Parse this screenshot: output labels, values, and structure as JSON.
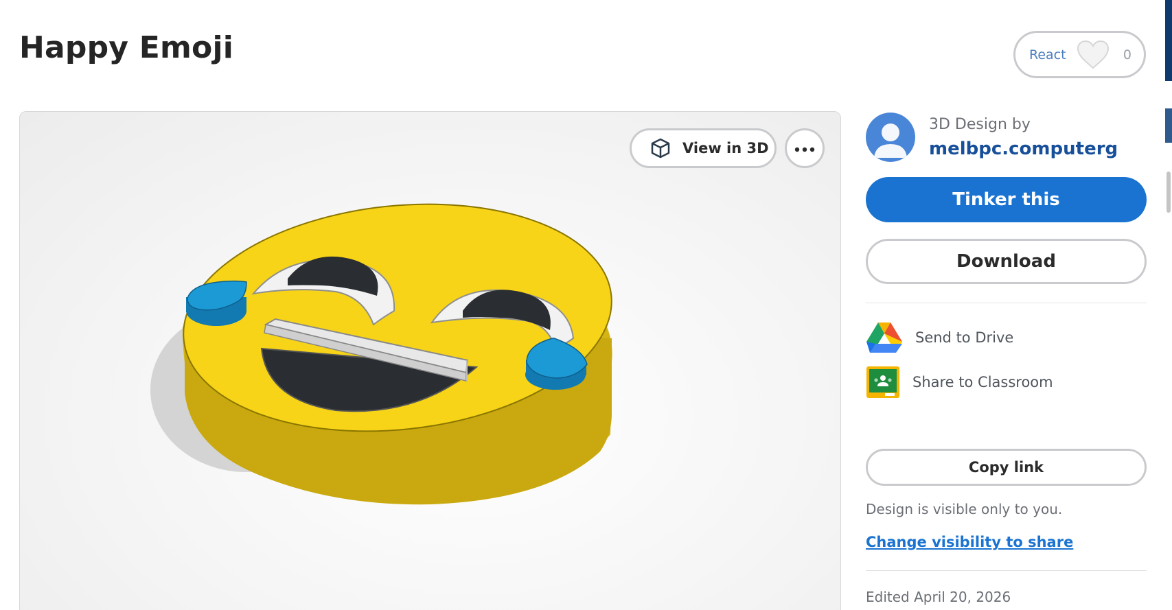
{
  "page": {
    "title": "Happy Emoji"
  },
  "react": {
    "label": "React",
    "count": "0",
    "icon": "heart-icon"
  },
  "viewer": {
    "view3d_label": "View in 3D",
    "view3d_icon": "cube-icon",
    "more_icon": "more-options-icon"
  },
  "designer": {
    "caption": "3D Design by",
    "name": "melbpc.computerg"
  },
  "actions": {
    "tinker_label": "Tinker this",
    "download_label": "Download",
    "send_drive_label": "Send to Drive",
    "share_classroom_label": "Share to Classroom",
    "copy_link_label": "Copy link"
  },
  "visibility": {
    "note": "Design is visible only to you.",
    "link": "Change visibility to share"
  },
  "meta": {
    "edited": "Edited April 20, 2026"
  },
  "colors": {
    "accent": "#1a73d1",
    "emoji_yellow": "#f7d417",
    "tear_blue": "#1c9ad6"
  }
}
